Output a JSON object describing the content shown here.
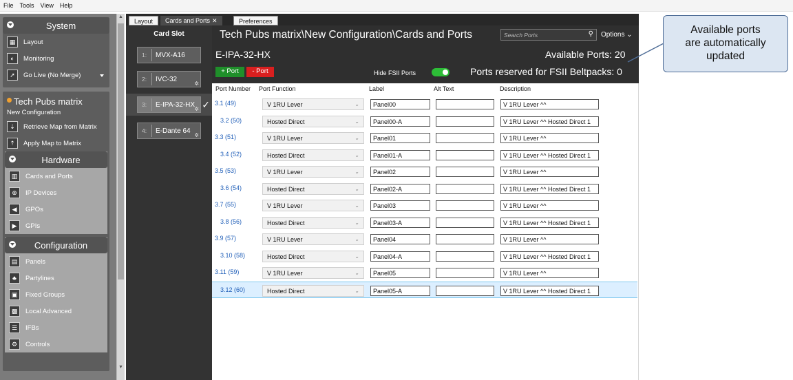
{
  "menu": [
    "File",
    "Tools",
    "View",
    "Help"
  ],
  "sidebar": {
    "system_group": "System",
    "system_items": [
      {
        "label": "Layout",
        "icon": "layout-icon"
      },
      {
        "label": "Monitoring",
        "icon": "monitoring-icon"
      },
      {
        "label": "Go Live (No Merge)",
        "icon": "go-live-icon"
      }
    ],
    "matrix_title": "Tech Pubs matrix",
    "matrix_subtitle": "New Configuration",
    "matrix_items": [
      {
        "label": "Retrieve Map from Matrix",
        "icon": "retrieve-map-icon"
      },
      {
        "label": "Apply Map to Matrix",
        "icon": "apply-map-icon"
      }
    ],
    "hardware_group": "Hardware",
    "hardware_items": [
      {
        "label": "Cards and Ports",
        "icon": "cards-ports-icon"
      },
      {
        "label": "IP Devices",
        "icon": "ip-devices-icon"
      },
      {
        "label": "GPOs",
        "icon": "gpo-icon"
      },
      {
        "label": "GPIs",
        "icon": "gpi-icon"
      }
    ],
    "configuration_group": "Configuration",
    "configuration_items": [
      {
        "label": "Panels",
        "icon": "panels-icon"
      },
      {
        "label": "Partylines",
        "icon": "partylines-icon"
      },
      {
        "label": "Fixed Groups",
        "icon": "fixed-groups-icon"
      },
      {
        "label": "Local Advanced",
        "icon": "local-advanced-icon"
      },
      {
        "label": "IFBs",
        "icon": "ifb-icon"
      },
      {
        "label": "Controls",
        "icon": "controls-icon"
      }
    ]
  },
  "tabs": {
    "layout": "Layout",
    "active": "Cards and Ports",
    "close": "✕",
    "preferences": "Preferences"
  },
  "card_slot": {
    "title": "Card Slot",
    "cards": [
      {
        "num": "1:",
        "name": "MVX-A16"
      },
      {
        "num": "2:",
        "name": "IVC-32"
      },
      {
        "num": "3:",
        "name": "E-IPA-32-HX"
      },
      {
        "num": "4:",
        "name": "E-Dante 64"
      }
    ]
  },
  "header": {
    "breadcrumb": "Tech Pubs matrix\\New Configuration\\Cards and Ports",
    "search_placeholder": "Search Ports",
    "options": "Options",
    "card_name": "E-IPA-32-HX",
    "available_ports": "Available Ports: 20",
    "add_port": "+ Port",
    "remove_port": "- Port",
    "hide_fsii": "Hide FSII Ports",
    "reserved": "Ports reserved for FSII Beltpacks: 0"
  },
  "columns": {
    "port_number": "Port Number",
    "port_function": "Port Function",
    "label": "Label",
    "alt_text": "Alt Text",
    "description": "Description"
  },
  "rows": [
    {
      "port": "3.1 (49)",
      "func": "V 1RU Lever",
      "label": "Panel00",
      "alt": "",
      "desc": "V 1RU Lever ^^"
    },
    {
      "port": "3.2 (50)",
      "func": "Hosted Direct",
      "label": "Panel00-A",
      "alt": "",
      "desc": "V 1RU Lever ^^ Hosted Direct 1"
    },
    {
      "port": "3.3 (51)",
      "func": "V 1RU Lever",
      "label": "Panel01",
      "alt": "",
      "desc": "V 1RU Lever ^^"
    },
    {
      "port": "3.4 (52)",
      "func": "Hosted Direct",
      "label": "Panel01-A",
      "alt": "",
      "desc": "V 1RU Lever ^^ Hosted Direct 1"
    },
    {
      "port": "3.5 (53)",
      "func": "V 1RU Lever",
      "label": "Panel02",
      "alt": "",
      "desc": "V 1RU Lever ^^"
    },
    {
      "port": "3.6 (54)",
      "func": "Hosted Direct",
      "label": "Panel02-A",
      "alt": "",
      "desc": "V 1RU Lever ^^ Hosted Direct 1"
    },
    {
      "port": "3.7 (55)",
      "func": "V 1RU Lever",
      "label": "Panel03",
      "alt": "",
      "desc": "V 1RU Lever ^^"
    },
    {
      "port": "3.8 (56)",
      "func": "Hosted Direct",
      "label": "Panel03-A",
      "alt": "",
      "desc": "V 1RU Lever ^^ Hosted Direct 1"
    },
    {
      "port": "3.9 (57)",
      "func": "V 1RU Lever",
      "label": "Panel04",
      "alt": "",
      "desc": "V 1RU Lever ^^"
    },
    {
      "port": "3.10 (58)",
      "func": "Hosted Direct",
      "label": "Panel04-A",
      "alt": "",
      "desc": "V 1RU Lever ^^ Hosted Direct 1"
    },
    {
      "port": "3.11 (59)",
      "func": "V 1RU Lever",
      "label": "Panel05",
      "alt": "",
      "desc": "V 1RU Lever ^^"
    },
    {
      "port": "3.12 (60)",
      "func": "Hosted Direct",
      "label": "Panel05-A",
      "alt": "",
      "desc": "V 1RU Lever ^^ Hosted Direct 1"
    }
  ],
  "callout": {
    "line1": "Available ports",
    "line2": "are automatically",
    "line3": "updated"
  }
}
